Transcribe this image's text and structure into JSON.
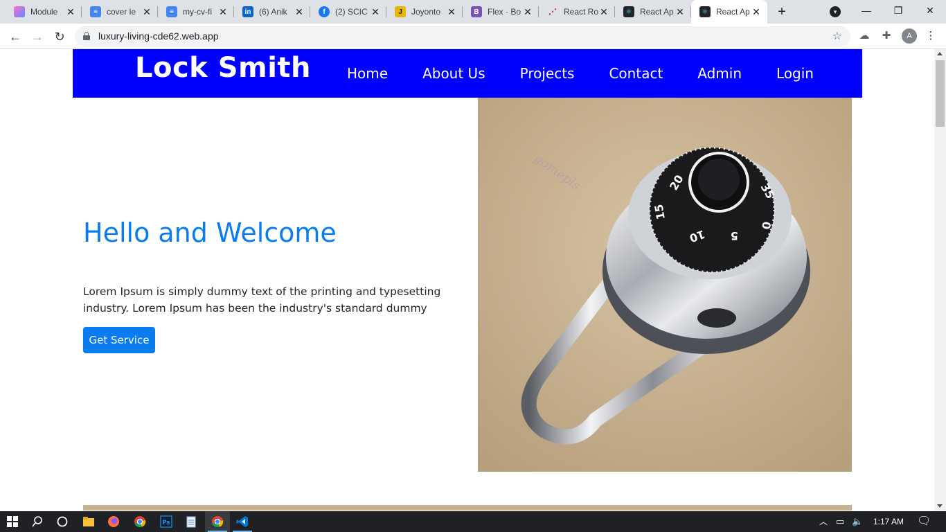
{
  "browser": {
    "tabs": [
      {
        "title": "Module",
        "icon": "module-favicon-icon",
        "color": "#7b61ff"
      },
      {
        "title": "cover le",
        "icon": "docs-icon",
        "color": "#4285f4"
      },
      {
        "title": "my-cv-fi",
        "icon": "docs-icon",
        "color": "#4285f4"
      },
      {
        "title": "(6) Anik",
        "icon": "linkedin-icon",
        "color": "#0a66c2"
      },
      {
        "title": "(2) SCIC",
        "icon": "facebook-icon",
        "color": "#1877f2"
      },
      {
        "title": "Joyonto",
        "icon": "joyonto-favicon-icon",
        "color": "#e8b600"
      },
      {
        "title": "Flex · Bo",
        "icon": "bootstrap-icon",
        "color": "#7952b3"
      },
      {
        "title": "React Ro",
        "icon": "react-router-icon",
        "color": "#ca4245"
      },
      {
        "title": "React Ap",
        "icon": "react-icon",
        "color": "#20232a"
      },
      {
        "title": "React Ap",
        "icon": "react-icon",
        "color": "#20232a"
      }
    ],
    "active_tab": 9,
    "url": "luxury-living-cde62.web.app",
    "profile_initial": "A"
  },
  "site": {
    "brand": "Lock Smith",
    "nav": [
      "Home",
      "About Us",
      "Projects",
      "Contact",
      "Admin",
      "Login"
    ],
    "hero": {
      "title": "Hello and Welcome",
      "text": "Lorem Ipsum is simply dummy text of the printing and typesetting industry. Lorem Ipsum has been the industry's standard dummy",
      "button": "Get Service"
    },
    "image": {
      "dial_numbers": [
        "20",
        "35",
        "15",
        "0",
        "10",
        "5"
      ],
      "watermark": "gomepls"
    },
    "colors": {
      "nav_bg": "#0000ff",
      "accent": "#0a7cf0",
      "image_bg": "#c9b291"
    }
  },
  "taskbar": {
    "time": "1:17 AM",
    "apps": [
      "windows-start-icon",
      "search-icon",
      "cortana-icon",
      "file-explorer-icon",
      "firefox-icon",
      "chrome-icon",
      "photoshop-icon",
      "notepad-icon",
      "chrome-active-icon",
      "vscode-icon"
    ]
  }
}
